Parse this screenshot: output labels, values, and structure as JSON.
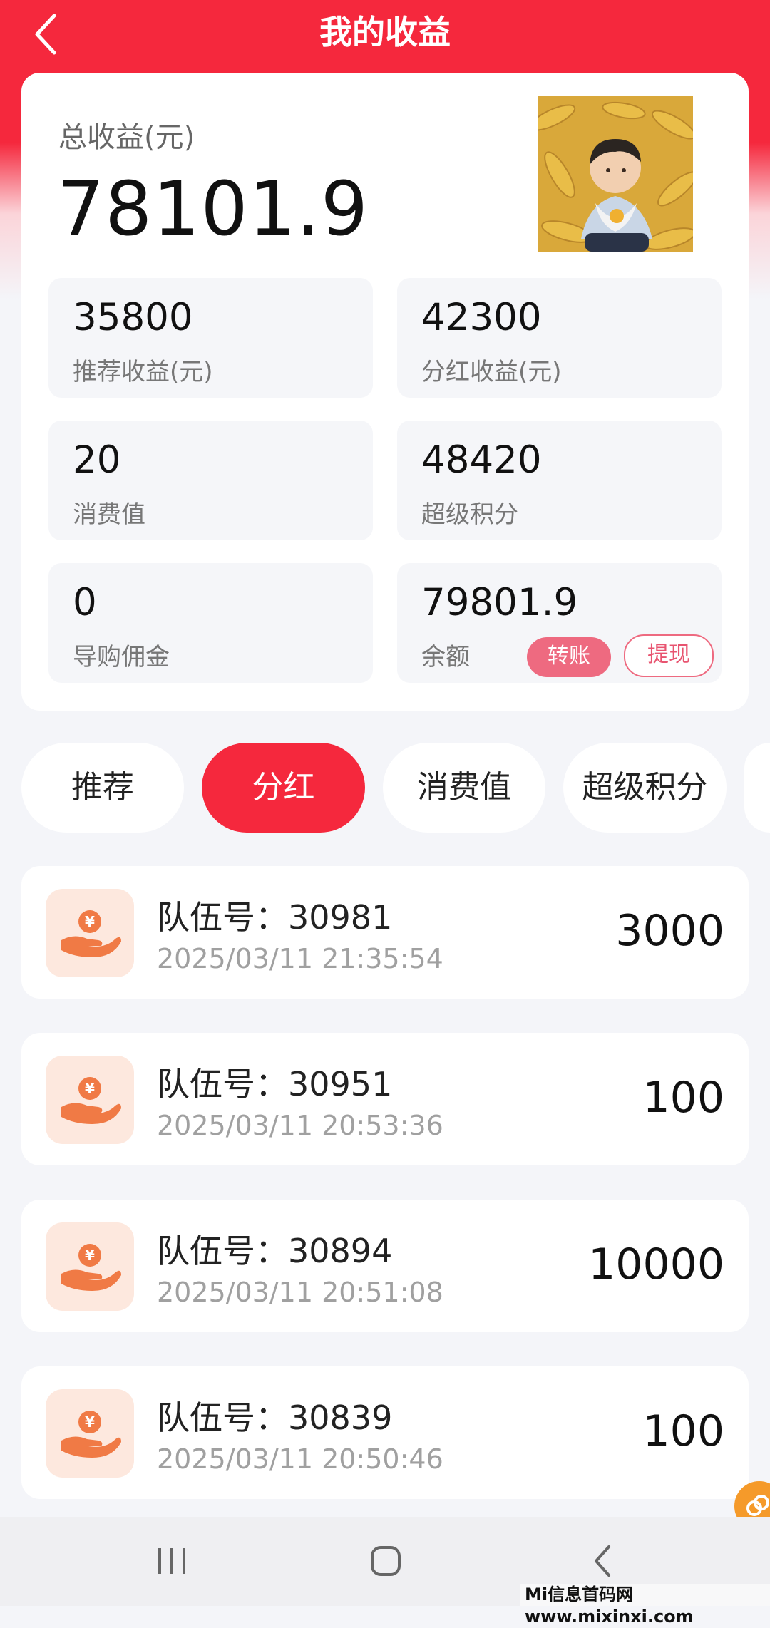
{
  "header": {
    "title": "我的收益"
  },
  "summary": {
    "total_label": "总收益(元)",
    "total_value": "78101.9"
  },
  "stats": {
    "recommend": {
      "value": "35800",
      "label": "推荐收益(元)"
    },
    "dividend": {
      "value": "42300",
      "label": "分红收益(元)"
    },
    "consumption": {
      "value": "20",
      "label": "消费值"
    },
    "super_points": {
      "value": "48420",
      "label": "超级积分"
    },
    "shopping_commission": {
      "value": "0",
      "label": "导购佣金"
    },
    "balance": {
      "value": "79801.9",
      "label": "余额",
      "transfer_label": "转账",
      "withdraw_label": "提现"
    }
  },
  "tabs": [
    {
      "label": "推荐",
      "active": false
    },
    {
      "label": "分红",
      "active": true
    },
    {
      "label": "消费值",
      "active": false
    },
    {
      "label": "超级积分",
      "active": false
    }
  ],
  "records": [
    {
      "team": "队伍号：30981",
      "time": "2025/03/11 21:35:54",
      "amount": "3000"
    },
    {
      "team": "队伍号：30951",
      "time": "2025/03/11 20:53:36",
      "amount": "100"
    },
    {
      "team": "队伍号：30894",
      "time": "2025/03/11 20:51:08",
      "amount": "10000"
    },
    {
      "team": "队伍号：30839",
      "time": "2025/03/11 20:50:46",
      "amount": "100"
    }
  ],
  "watermark": "Mi信息首码网 www.mixinxi.com",
  "colors": {
    "brand_red": "#f5283d",
    "pill_pink": "#ee6a80",
    "icon_orange": "#f07a45",
    "icon_bg": "#fde8de"
  },
  "icons": {
    "back": "chevron-left-icon",
    "record": "money-hand-icon",
    "nav_recent": "recent-apps-icon",
    "nav_home": "home-icon",
    "nav_back": "back-icon"
  }
}
